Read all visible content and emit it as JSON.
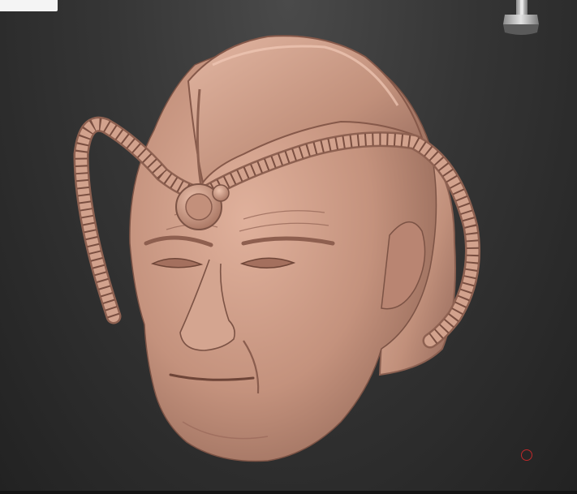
{
  "viewport": {
    "background_top": "#4a4a4a",
    "background_bottom": "#222222",
    "clay_color": "#c99a86"
  },
  "icons": {
    "view_gizmo": "orientation-gizmo-icon",
    "cursor": "brush-cursor-icon"
  }
}
